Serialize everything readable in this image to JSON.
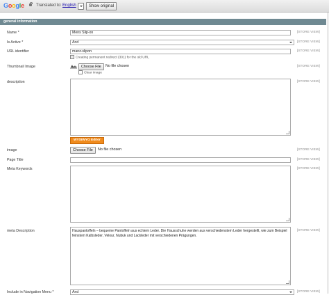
{
  "translate_bar": {
    "logo_letters": [
      {
        "ch": "G",
        "color": "#4285f4"
      },
      {
        "ch": "o",
        "color": "#ea4335"
      },
      {
        "ch": "o",
        "color": "#fbbc05"
      },
      {
        "ch": "g",
        "color": "#4285f4"
      },
      {
        "ch": "l",
        "color": "#34a853"
      },
      {
        "ch": "e",
        "color": "#ea4335"
      }
    ],
    "translated_to_label": "Translated to:",
    "language": "English",
    "show_original_button": "Show original"
  },
  "section": {
    "title": "general information"
  },
  "scope_label": "[STORE VIEW]",
  "fields": {
    "name": {
      "label": "Name *",
      "value": "Mens Slip-on"
    },
    "is_active": {
      "label": "Is Active *",
      "value": "And"
    },
    "url_identifier": {
      "label": "URL identifier",
      "value": "manz-slipon",
      "redirect_note": "Creating permanent redirect (301) for the old URL"
    },
    "thumbnail_image": {
      "label": "Thumbnail Image",
      "button": "Choose File",
      "file_status": "No file chosen",
      "clear_label": "Clear image"
    },
    "description": {
      "label": "description",
      "value": ""
    },
    "wysiwyg_button": "WYSIWYG Editor",
    "image": {
      "label": "image",
      "button": "Choose File",
      "file_status": "No file chosen"
    },
    "page_title": {
      "label": "Page Title",
      "value": ""
    },
    "meta_keywords": {
      "label": "Meta Keywords",
      "value": ""
    },
    "meta_description": {
      "label": "meta Description",
      "value": "Hauspantoffeln – bequeme Pantoffeln aus echtem Leder. Die Hausschuhe werden aus verschiedenstem Leder hergestellt, wie zum Beispiel feinstem Kalbsleder, Velour, Nubuk und Lackleder mit verschiedenen Prägungen."
    },
    "include_nav": {
      "label": "Include in Navigation Menu *",
      "value": "And"
    }
  }
}
